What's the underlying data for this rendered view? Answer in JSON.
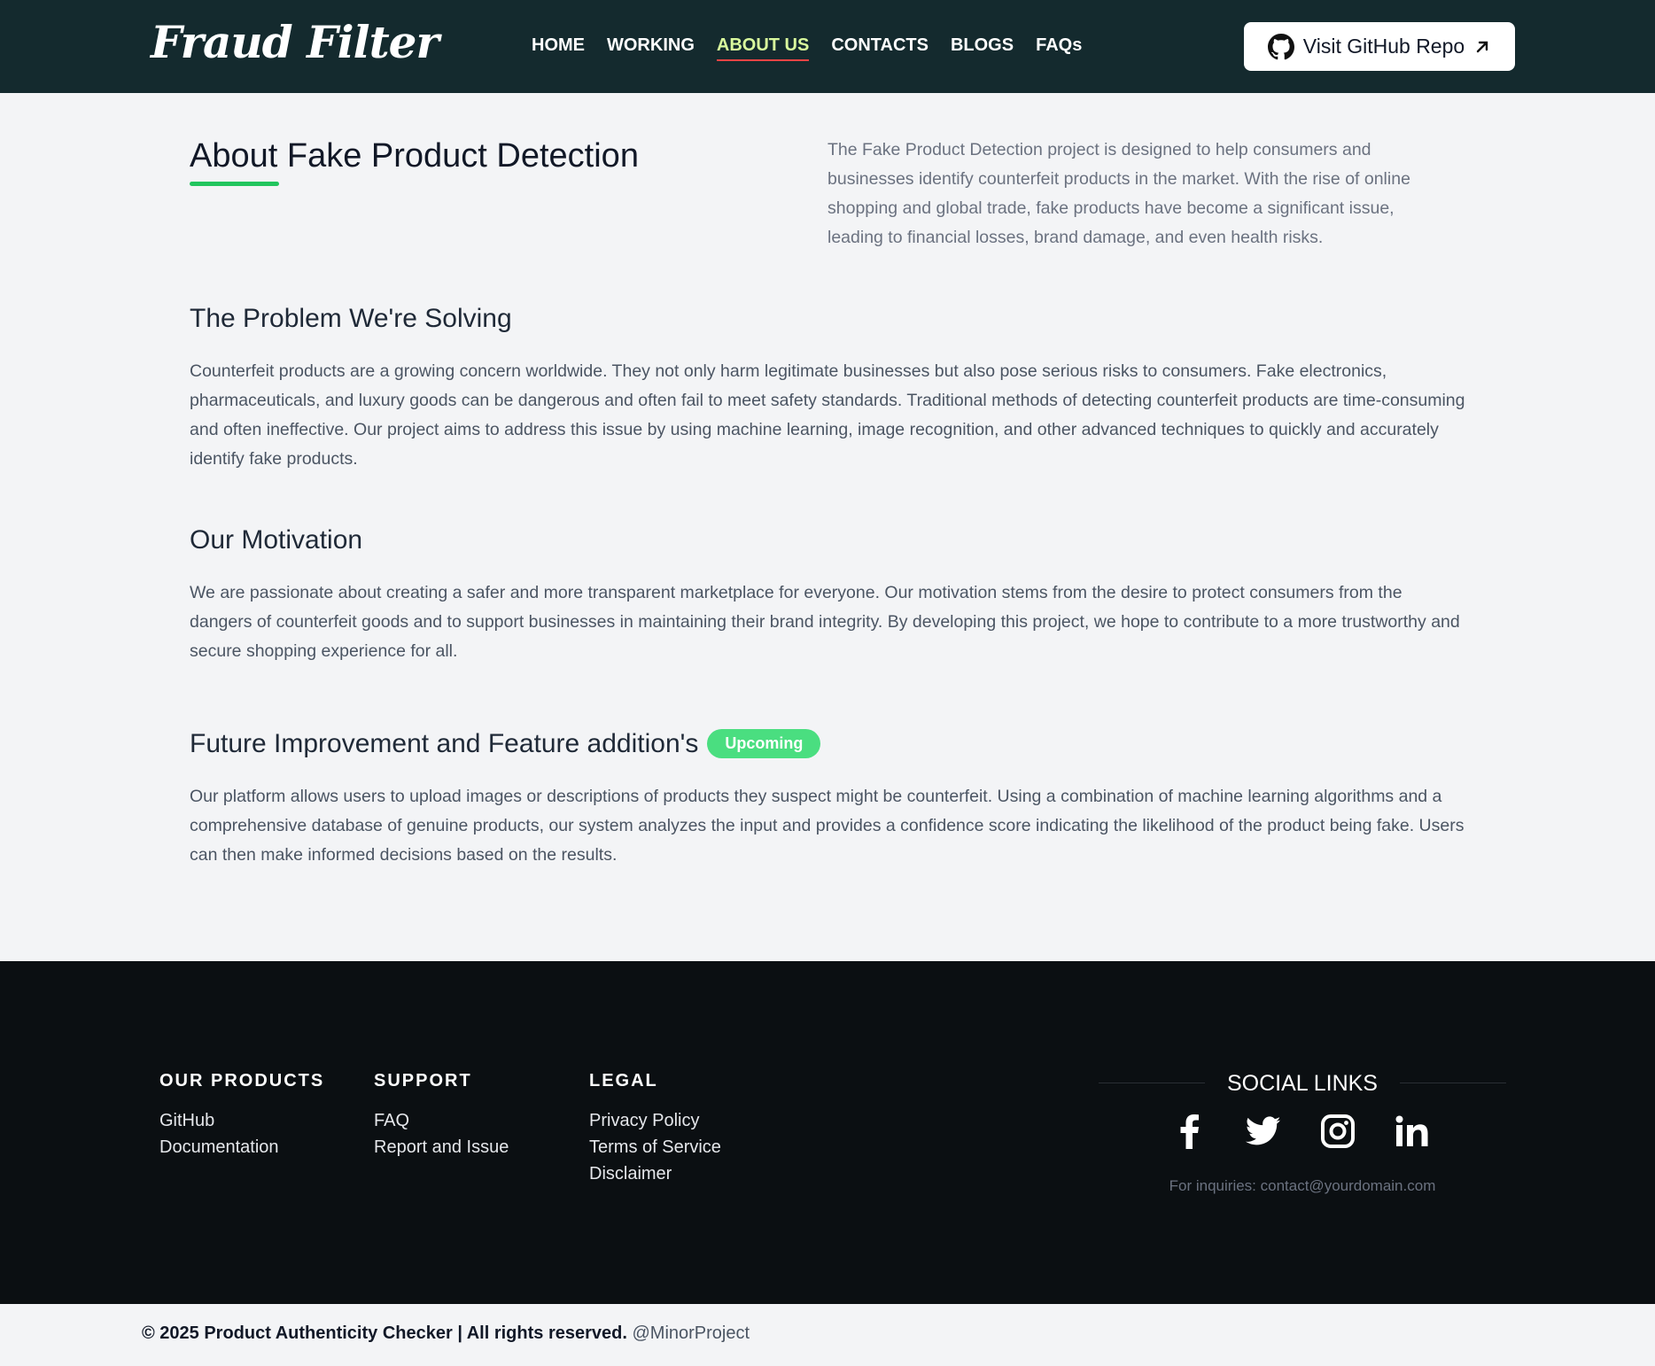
{
  "header": {
    "logo": "Fraud Filter",
    "nav": [
      "HOME",
      "WORKING",
      "ABOUT US",
      "CONTACTS",
      "BLOGS",
      "FAQs"
    ],
    "active_nav": "ABOUT US",
    "github_button": "Visit GitHub Repo"
  },
  "about": {
    "title": "About Fake Product Detection",
    "description": "The Fake Product Detection project is designed to help consumers and businesses identify counterfeit products in the market. With the rise of online shopping and global trade, fake products have become a significant issue, leading to financial losses, brand damage, and even health risks."
  },
  "problem": {
    "title": "The Problem We're Solving",
    "text": "Counterfeit products are a growing concern worldwide. They not only harm legitimate businesses but also pose serious risks to consumers. Fake electronics, pharmaceuticals, and luxury goods can be dangerous and often fail to meet safety standards. Traditional methods of detecting counterfeit products are time-consuming and often ineffective. Our project aims to address this issue by using machine learning, image recognition, and other advanced techniques to quickly and accurately identify fake products."
  },
  "motivation": {
    "title": "Our Motivation",
    "text": "We are passionate about creating a safer and more transparent marketplace for everyone. Our motivation stems from the desire to protect consumers from the dangers of counterfeit goods and to support businesses in maintaining their brand integrity. By developing this project, we hope to contribute to a more trustworthy and secure shopping experience for all."
  },
  "future": {
    "title": "Future Improvement and Feature addition's",
    "badge": "Upcoming",
    "text": "Our platform allows users to upload images or descriptions of products they suspect might be counterfeit. Using a combination of machine learning algorithms and a comprehensive database of genuine products, our system analyzes the input and provides a confidence score indicating the likelihood of the product being fake. Users can then make informed decisions based on the results."
  },
  "footer": {
    "products": {
      "title": "OUR PRODUCTS",
      "links": [
        "GitHub",
        "Documentation"
      ]
    },
    "support": {
      "title": "SUPPORT",
      "links": [
        "FAQ",
        "Report and Issue"
      ]
    },
    "legal": {
      "title": "LEGAL",
      "links": [
        "Privacy Policy",
        "Terms of Service",
        "Disclaimer"
      ]
    },
    "social": {
      "title": "SOCIAL LINKS",
      "icons": [
        "facebook-icon",
        "twitter-icon",
        "instagram-icon",
        "linkedin-icon"
      ],
      "inquiry": "For inquiries: contact@yourdomain.com"
    }
  },
  "bottom": {
    "copyright": "© 2025 Product Authenticity Checker | All rights reserved.",
    "handle": "@MinorProject"
  },
  "colors": {
    "header_bg": "#142a2e",
    "accent_green": "#22c55e",
    "badge_green": "#4ade80",
    "active_nav": "#d9f99d",
    "active_underline": "#ef4444",
    "footer_bg": "#0b0f12"
  }
}
